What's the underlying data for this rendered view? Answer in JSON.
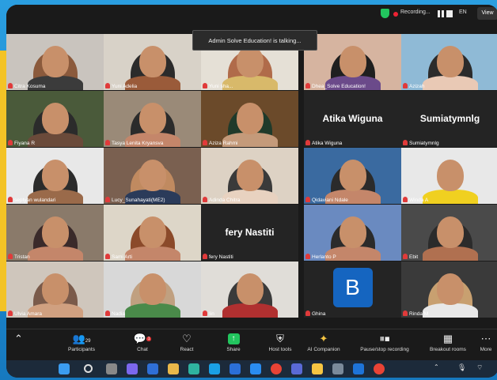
{
  "topbar": {
    "recording_label": "Recording...",
    "lang": "EN",
    "view_label": "View"
  },
  "toast": {
    "talking": "Admin Solve Education! is talking..."
  },
  "tiles": [
    {
      "name": "Citra Kosuma"
    },
    {
      "name": "Yuni Adelia"
    },
    {
      "name": "Yuni sha..."
    },
    {
      "name": "Dhea_Solve Education!"
    },
    {
      "name": "Azizah"
    },
    {
      "name": "Fiyana R"
    },
    {
      "name": "Tasya Lenita Kryansva"
    },
    {
      "name": "Aziza Rahmi"
    },
    {
      "name": "Atika Wiguna",
      "big": "Atika Wiguna"
    },
    {
      "name": "Sumiatymnlg",
      "big": "Sumiatymnlg"
    },
    {
      "name": "septyan wulandari"
    },
    {
      "name": "Lucy_Sunahayati(ME2)"
    },
    {
      "name": "Adinda Chitra"
    },
    {
      "name": "Qidaviani Ndale"
    },
    {
      "name": "Winda A"
    },
    {
      "name": "Tristan"
    },
    {
      "name": "Sami Arti"
    },
    {
      "name": "fery Nastiti",
      "big": "fery Nastiti"
    },
    {
      "name": "Herlanto P"
    },
    {
      "name": "Ebit"
    },
    {
      "name": "Ulvia Amara"
    },
    {
      "name": "Nadia"
    },
    {
      "name": "Iin"
    },
    {
      "name": "Ghina",
      "initial": "B"
    },
    {
      "name": "Rinda M"
    }
  ],
  "toolbar": {
    "participants_count": "29",
    "chat_badge": "1",
    "items": [
      {
        "label": "Participants"
      },
      {
        "label": "Chat"
      },
      {
        "label": "React"
      },
      {
        "label": "Share"
      },
      {
        "label": "Host tools"
      },
      {
        "label": "AI Companion"
      },
      {
        "label": "Pause/stop recording"
      },
      {
        "label": "Breakout rooms"
      },
      {
        "label": "More"
      }
    ]
  },
  "colors": {
    "accent": "#f3c326",
    "share": "#22c55e",
    "frame": "#1e8fd0",
    "mute": "#e03a3a"
  }
}
